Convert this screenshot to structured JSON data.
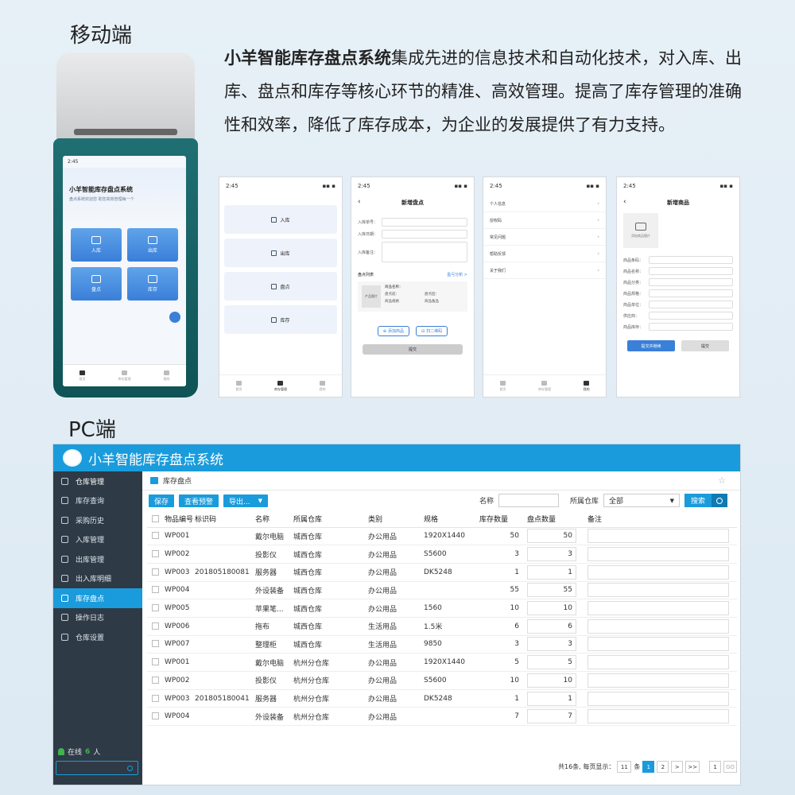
{
  "labels": {
    "mobile": "移动端",
    "pc": "PC端"
  },
  "intro": {
    "bold": "小羊智能库存盘点系统",
    "text": "集成先进的信息技术和自动化技术，对入库、出库、盘点和库存等核心环节的精准、高效管理。提高了库存管理的准确性和效率，降低了库存成本，为企业的发展提供了有力支持。"
  },
  "device": {
    "time": "2:45",
    "app_title": "小羊智能库存盘点系统",
    "subtitle": "盘点系统欢迎您 助您高效管理每一个",
    "tiles": [
      "入库",
      "出库",
      "盘点",
      "库存"
    ],
    "nav": [
      "首页",
      "库存管理",
      "我的"
    ]
  },
  "screen1": {
    "time": "2:45",
    "menu": [
      "入库",
      "出库",
      "盘点",
      "库存"
    ],
    "nav": [
      "首页",
      "库存管理",
      "我的"
    ]
  },
  "screen2": {
    "time": "2:45",
    "title": "新增盘点",
    "fields": [
      "入库单号：",
      "入库日期：",
      "入库备注："
    ],
    "list_title": "盘点列表",
    "list_link": "盈亏分析 >",
    "item": {
      "img": "产品图片",
      "name": "商品名称：",
      "a": "盘点前：",
      "b": "盘点后：",
      "c": "商品规格",
      "d": "商品备品"
    },
    "btn_add": "添加商品",
    "btn_scan": "扫二维码",
    "submit": "提交"
  },
  "screen3": {
    "time": "2:45",
    "items": [
      "个人信息",
      "授权码",
      "常见问题",
      "帮助反馈",
      "关于我们"
    ],
    "nav": [
      "首页",
      "库存管理",
      "我的"
    ]
  },
  "screen4": {
    "time": "2:45",
    "title": "新增商品",
    "photo": "添加商品图片",
    "fields": [
      "商品条码：",
      "商品名称：",
      "商品分类：",
      "商品规格：",
      "商品单位：",
      "供应商：",
      "商品库存："
    ],
    "btn1": "提交并继续",
    "btn2": "提交"
  },
  "pc": {
    "title": "小羊智能库存盘点系统",
    "side": [
      "仓库管理",
      "库存查询",
      "采购历史",
      "入库管理",
      "出库管理",
      "出入库明细",
      "库存盘点",
      "操作日志",
      "仓库设置"
    ],
    "online_label": "在线",
    "online_count": "6",
    "online_unit": "人",
    "crumb": "库存盘点",
    "buttons": {
      "save": "保存",
      "warn": "查看预警",
      "export": "导出..."
    },
    "filter": {
      "name_label": "名称",
      "wh_label": "所属仓库",
      "wh_value": "全部",
      "search": "搜索"
    },
    "headers": [
      "物品编号",
      "标识码",
      "名称",
      "所属仓库",
      "类别",
      "规格",
      "库存数量",
      "盘点数量",
      "备注"
    ],
    "rows": [
      {
        "code": "WP001",
        "tag": "",
        "name": "戴尔电脑",
        "wh": "城西仓库",
        "cat": "办公用品",
        "spec": "1920X1440",
        "stock": "50",
        "count": "50"
      },
      {
        "code": "WP002",
        "tag": "",
        "name": "投影仪",
        "wh": "城西仓库",
        "cat": "办公用品",
        "spec": "S5600",
        "stock": "3",
        "count": "3"
      },
      {
        "code": "WP003",
        "tag": "201805180081",
        "name": "服务器",
        "wh": "城西仓库",
        "cat": "办公用品",
        "spec": "DK5248",
        "stock": "1",
        "count": "1"
      },
      {
        "code": "WP004",
        "tag": "",
        "name": "外设装备",
        "wh": "城西仓库",
        "cat": "办公用品",
        "spec": "",
        "stock": "55",
        "count": "55"
      },
      {
        "code": "WP005",
        "tag": "",
        "name": "苹果笔...",
        "wh": "城西仓库",
        "cat": "办公用品",
        "spec": "1560",
        "stock": "10",
        "count": "10"
      },
      {
        "code": "WP006",
        "tag": "",
        "name": "拖布",
        "wh": "城西仓库",
        "cat": "生活用品",
        "spec": "1.5米",
        "stock": "6",
        "count": "6"
      },
      {
        "code": "WP007",
        "tag": "",
        "name": "整理柜",
        "wh": "城西仓库",
        "cat": "生活用品",
        "spec": "9850",
        "stock": "3",
        "count": "3"
      },
      {
        "code": "WP001",
        "tag": "",
        "name": "戴尔电脑",
        "wh": "杭州分仓库",
        "cat": "办公用品",
        "spec": "1920X1440",
        "stock": "5",
        "count": "5"
      },
      {
        "code": "WP002",
        "tag": "",
        "name": "投影仪",
        "wh": "杭州分仓库",
        "cat": "办公用品",
        "spec": "S5600",
        "stock": "10",
        "count": "10"
      },
      {
        "code": "WP003",
        "tag": "201805180041",
        "name": "服务器",
        "wh": "杭州分仓库",
        "cat": "办公用品",
        "spec": "DK5248",
        "stock": "1",
        "count": "1"
      },
      {
        "code": "WP004",
        "tag": "",
        "name": "外设装备",
        "wh": "杭州分仓库",
        "cat": "办公用品",
        "spec": "",
        "stock": "7",
        "count": "7"
      }
    ],
    "pager": {
      "total": "共16条, 每页显示：",
      "size": "11",
      "unit": "条",
      "p1": "1",
      "p2": "2",
      "next": ">",
      "last": ">>",
      "jump": "1",
      "go": "GO"
    }
  }
}
